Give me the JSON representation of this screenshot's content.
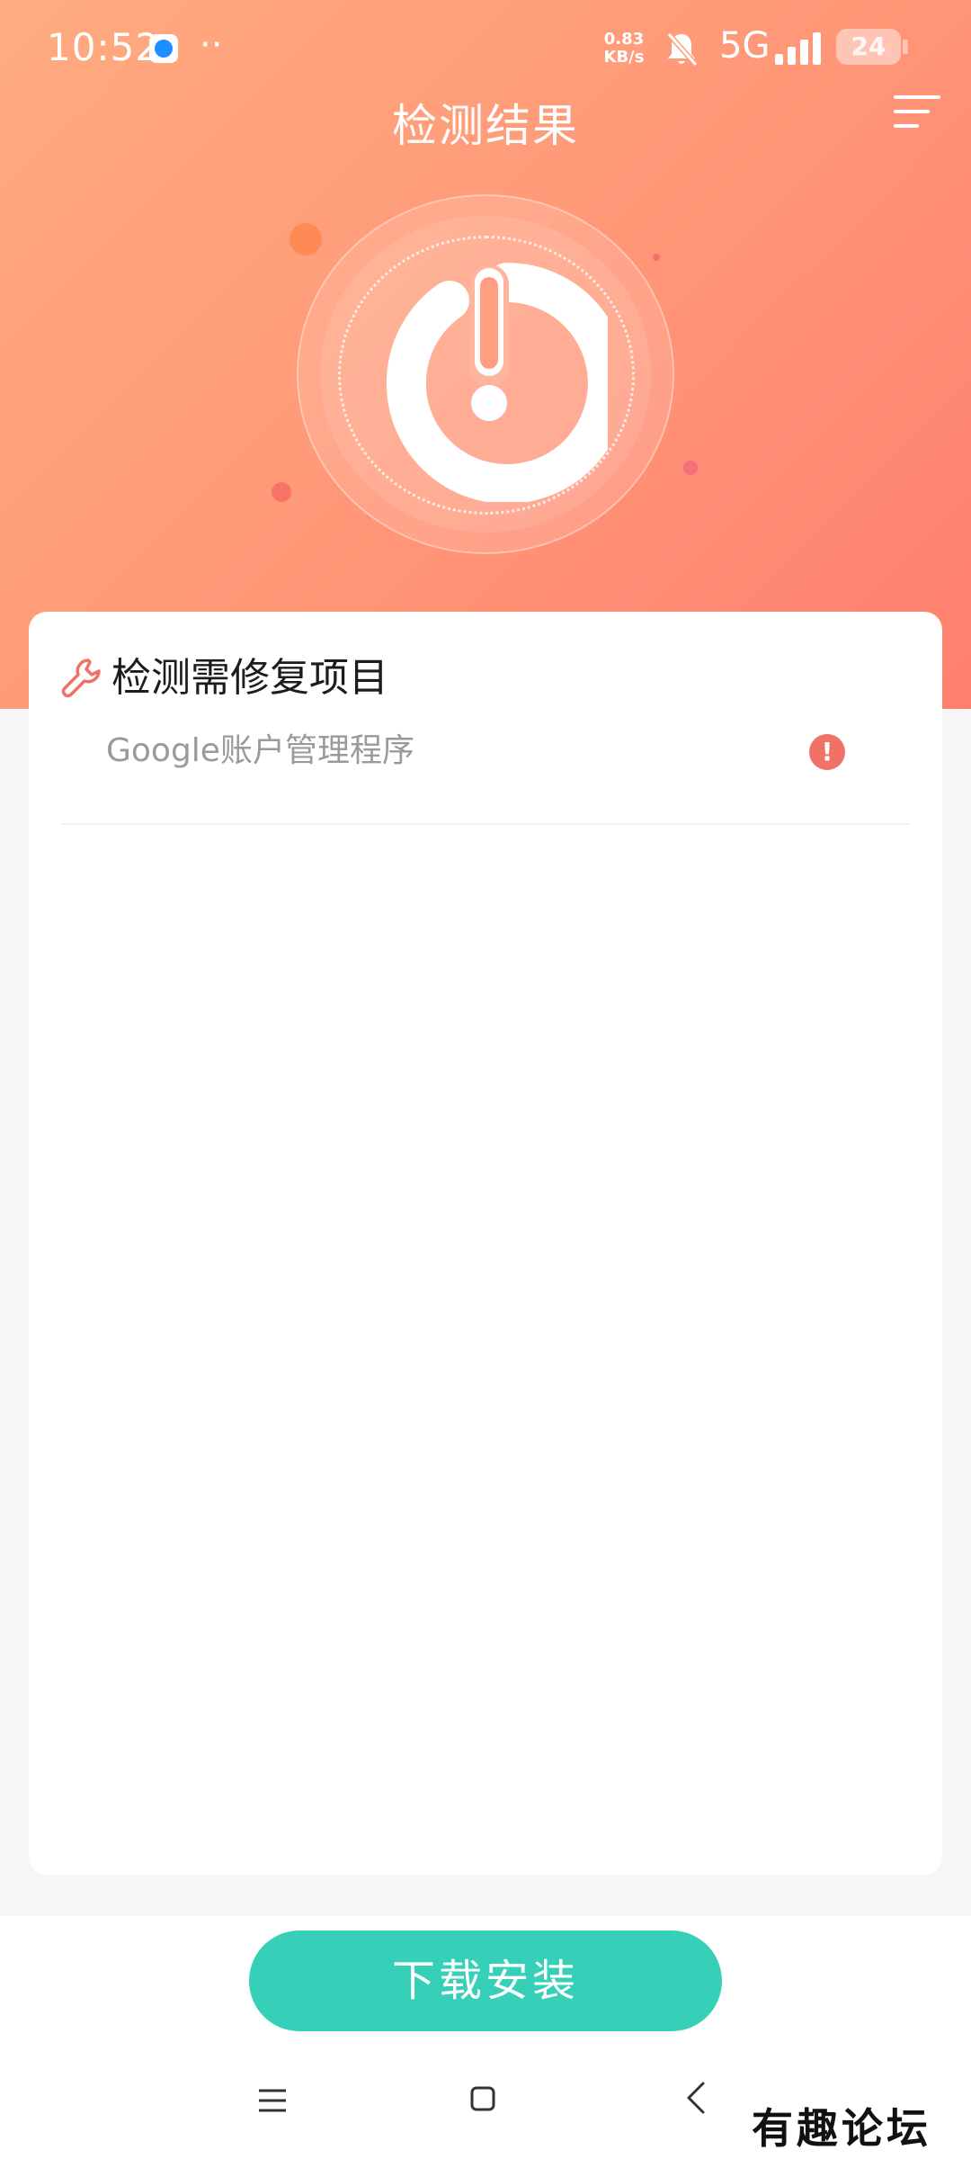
{
  "status_bar": {
    "time": "10:52",
    "dots": "··",
    "speed_value": "0.83",
    "speed_unit": "KB/s",
    "network": "5G",
    "battery": "24",
    "icons": [
      "app-badge-icon",
      "bell-muted-icon",
      "signal-icon",
      "battery-icon"
    ]
  },
  "header": {
    "title": "检测结果",
    "menu_icon": "menu-lines-icon"
  },
  "hero": {
    "icon": "power-alert-icon"
  },
  "card": {
    "section_title": "检测需修复项目",
    "section_icon": "wrench-icon",
    "items": [
      {
        "label": "Google账户管理程序",
        "status_icon": "alert-icon",
        "status_glyph": "!"
      }
    ]
  },
  "actions": {
    "primary_label": "下载安装"
  },
  "nav": {
    "icons": [
      "recents-menu-icon",
      "home-icon",
      "back-icon"
    ]
  },
  "watermark": "有趣论坛",
  "colors": {
    "accent_gradient_start": "#ffab80",
    "accent_gradient_end": "#ff7f6f",
    "primary_button": "#36cfb8",
    "alert": "#f07166"
  }
}
